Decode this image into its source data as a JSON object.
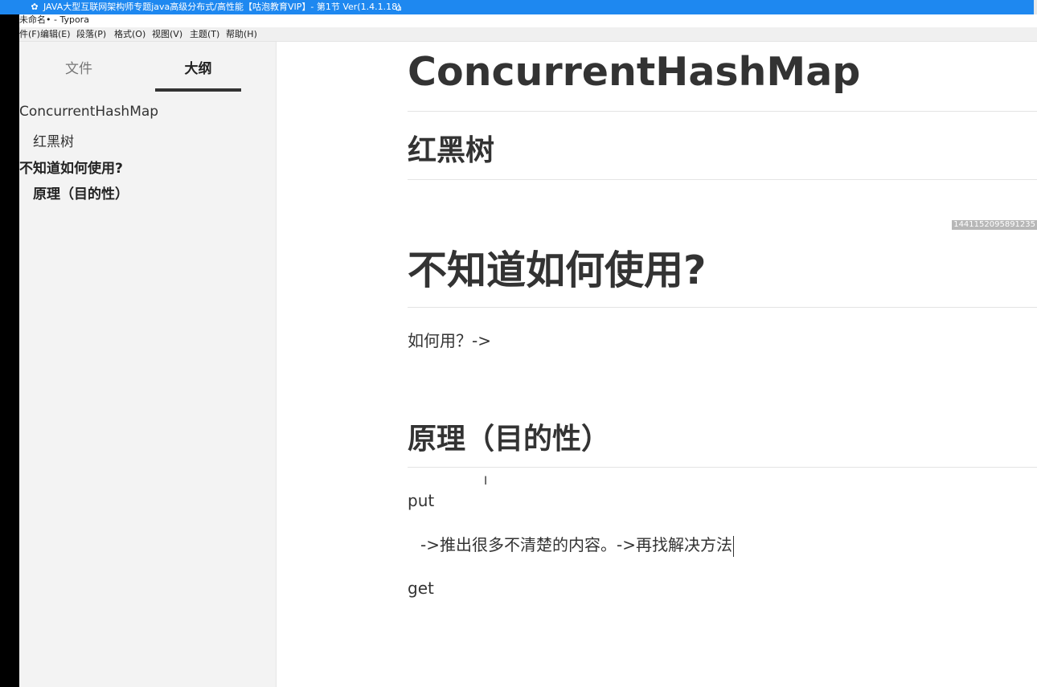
{
  "window": {
    "title": "JAVA大型互联网架构师专题java高级分布式/高性能【咕泡教育VIP】- 第1节 Ver(1.4.1.18)",
    "document_title": "未命名• - Typora"
  },
  "menu": {
    "items": [
      "件(F)",
      "编辑(E)",
      "段落(P)",
      "格式(O)",
      "视图(V)",
      "主题(T)",
      "帮助(H)"
    ]
  },
  "sidebar": {
    "tabs": [
      {
        "label": "文件",
        "active": false
      },
      {
        "label": "大纲",
        "active": true
      }
    ],
    "outline": [
      {
        "label": "ConcurrentHashMap",
        "level": 1,
        "bold": false
      },
      {
        "label": "红黑树",
        "level": 2,
        "bold": false
      },
      {
        "label": "不知道如何使用?",
        "level": 1,
        "bold": true
      },
      {
        "label": "原理（目的性）",
        "level": 2,
        "bold": true
      }
    ]
  },
  "editor": {
    "h1_title": "ConcurrentHashMap",
    "h2_rbtree": "红黑树",
    "floating_id": "1441152095891235",
    "h1_howto": "不知道如何使用?",
    "p_howto": "如何用？->",
    "h2_principle": "原理（目的性）",
    "p_put": "put",
    "p_arrow": "->推出很多不清楚的内容。->再找解决方法",
    "p_get": "get"
  },
  "colors": {
    "titlebar": "#1e88f0",
    "sidebar_bg": "#f3f3f3",
    "editor_bg": "#ffffff",
    "text": "#333333"
  }
}
